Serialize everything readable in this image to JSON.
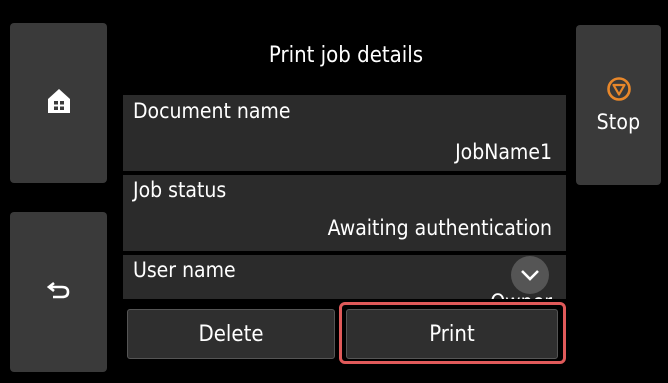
{
  "panel": {
    "title": "Print job details"
  },
  "rows": {
    "document_name": {
      "label": "Document name",
      "value": "JobName1"
    },
    "job_status": {
      "label": "Job status",
      "value": "Awaiting authentication"
    },
    "user_name": {
      "label": "User name",
      "value": "Owner"
    }
  },
  "side": {
    "home_icon": "home-icon",
    "back_icon": "back-arrow-icon",
    "stop_icon": "stop-icon",
    "stop_label": "Stop"
  },
  "actions": {
    "delete_label": "Delete",
    "print_label": "Print"
  },
  "colors": {
    "background": "#000000",
    "button": "#3a3a3a",
    "stop_accent": "#e8872a",
    "highlight": "#e05a5a"
  }
}
